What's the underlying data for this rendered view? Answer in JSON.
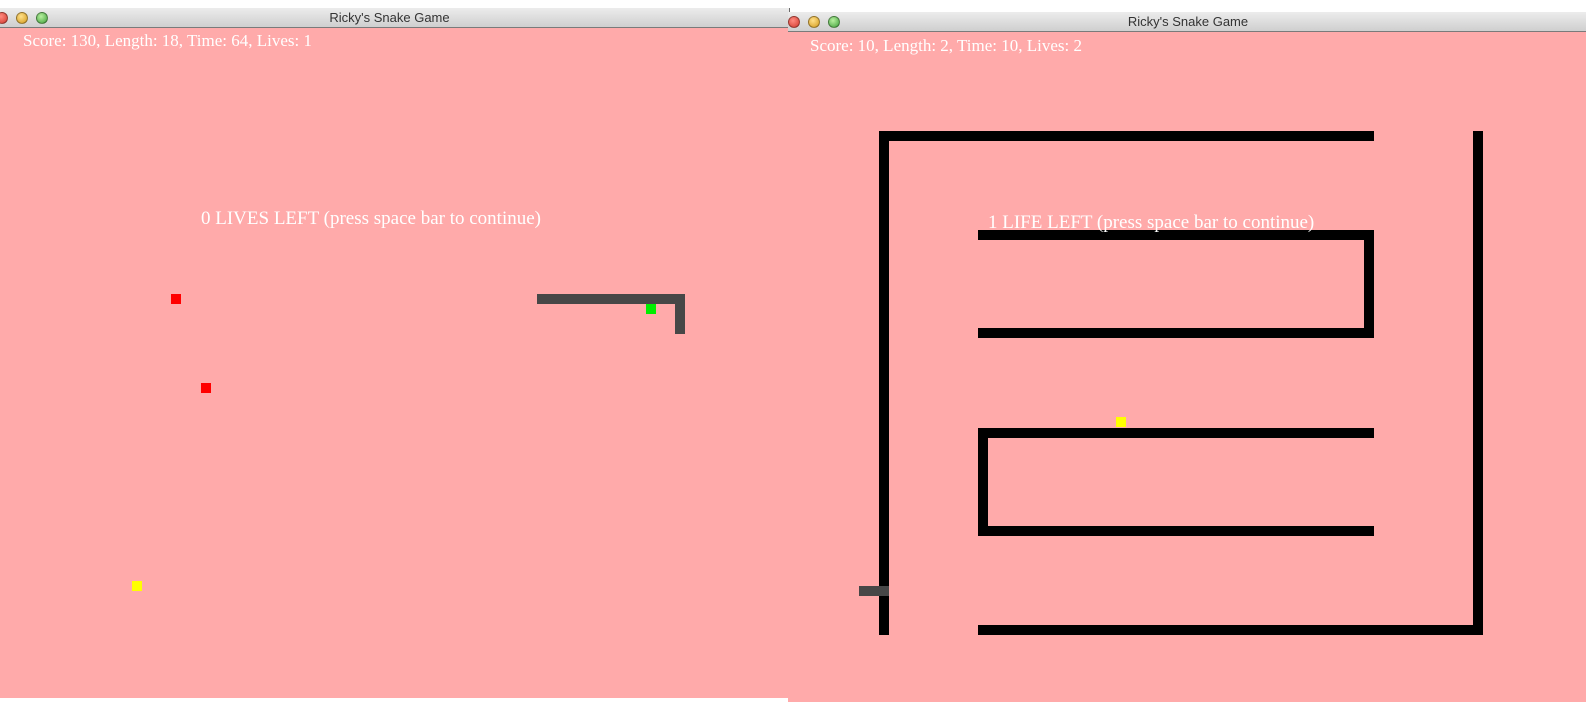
{
  "colors": {
    "board_background": "#ffaaaa",
    "wall": "#000000",
    "snake_body": "#474747",
    "snake_head": "#00ee00",
    "food_red": "#ff0000",
    "food_yellow": "#ffff00",
    "hud_text": "#ffffff"
  },
  "icons": {
    "close": "close-icon",
    "minimize": "minimize-icon",
    "zoom": "zoom-icon"
  },
  "left_window": {
    "title": "Ricky's Snake Game",
    "status": "Score: 130, Length: 18, Time: 64, Lives: 1",
    "message": "0 LIVES LEFT (press space bar to continue)"
  },
  "right_window": {
    "title": "Ricky's Snake Game",
    "status": "Score: 10, Length: 2, Time: 10, Lives: 2",
    "message": "1 LIFE LEFT (press space bar to continue)"
  }
}
